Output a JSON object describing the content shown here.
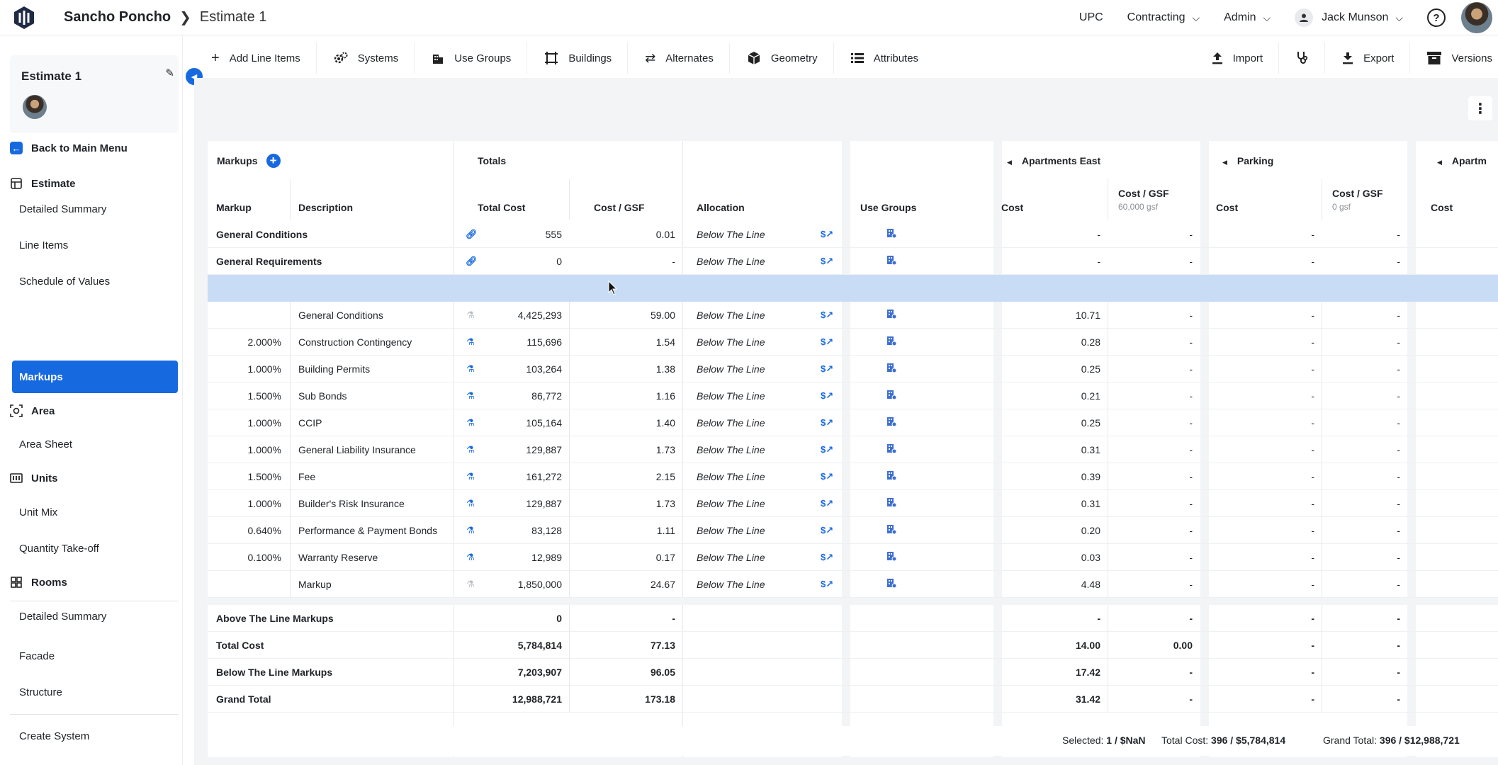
{
  "header": {
    "project": "Sancho Poncho",
    "estimate": "Estimate 1",
    "menu": [
      "UPC",
      "Contracting",
      "Admin"
    ],
    "user": "Jack Munson"
  },
  "sidebar": {
    "estimate_title": "Estimate 1",
    "back": "Back to Main Menu",
    "estimate_section": "Estimate",
    "estimate_items": [
      "Detailed Summary",
      "Line Items",
      "Schedule of Values",
      "Markups"
    ],
    "area_section": "Area",
    "area_items": [
      "Area Sheet"
    ],
    "units_section": "Units",
    "units_items": [
      "Unit Mix",
      "Quantity Take-off"
    ],
    "rooms_section": "Rooms",
    "rooms_items": [
      "Detailed Summary"
    ],
    "other_items": [
      "Facade",
      "Structure"
    ],
    "create": "Create System"
  },
  "toolbar": {
    "left": [
      "Add Line Items",
      "Systems",
      "Use Groups",
      "Buildings",
      "Alternates",
      "Geometry",
      "Attributes"
    ],
    "right": [
      "Import",
      "Export",
      "Versions"
    ]
  },
  "grid": {
    "groups": {
      "markups": "Markups",
      "totals": "Totals",
      "apartments_east": "Apartments East",
      "parking": "Parking",
      "apart_cut": "Apartm"
    },
    "headers": {
      "markup": "Markup",
      "description": "Description",
      "total_cost": "Total Cost",
      "cost_gsf": "Cost / GSF",
      "allocation": "Allocation",
      "use_groups": "Use Groups",
      "cost": "Cost",
      "apt_gsf": "60,000 gsf",
      "parking_gsf": "0 gsf"
    },
    "top_rows": [
      {
        "markup": "General Conditions",
        "total": "555",
        "gsf": "0.01",
        "alloc": "Below The Line",
        "ae_cost": "-",
        "ae_gsf": "-",
        "pk_cost": "-",
        "pk_gsf": "-"
      },
      {
        "markup": "General Requirements",
        "total": "0",
        "gsf": "-",
        "alloc": "Below The Line",
        "ae_cost": "-",
        "ae_gsf": "-",
        "pk_cost": "-",
        "pk_gsf": "-"
      }
    ],
    "rows": [
      {
        "pct": "",
        "desc": "General Conditions",
        "total": "4,425,293",
        "gsf": "59.00",
        "alloc": "Below The Line",
        "ae_cost": "10.71",
        "ae_gsf": "-",
        "pk_cost": "-",
        "pk_gsf": "-",
        "dim": true
      },
      {
        "pct": "2.000%",
        "desc": "Construction Contingency",
        "total": "115,696",
        "gsf": "1.54",
        "alloc": "Below The Line",
        "ae_cost": "0.28",
        "ae_gsf": "-",
        "pk_cost": "-",
        "pk_gsf": "-"
      },
      {
        "pct": "1.000%",
        "desc": "Building Permits",
        "total": "103,264",
        "gsf": "1.38",
        "alloc": "Below The Line",
        "ae_cost": "0.25",
        "ae_gsf": "-",
        "pk_cost": "-",
        "pk_gsf": "-"
      },
      {
        "pct": "1.500%",
        "desc": "Sub Bonds",
        "total": "86,772",
        "gsf": "1.16",
        "alloc": "Below The Line",
        "ae_cost": "0.21",
        "ae_gsf": "-",
        "pk_cost": "-",
        "pk_gsf": "-"
      },
      {
        "pct": "1.000%",
        "desc": "CCIP",
        "total": "105,164",
        "gsf": "1.40",
        "alloc": "Below The Line",
        "ae_cost": "0.25",
        "ae_gsf": "-",
        "pk_cost": "-",
        "pk_gsf": "-"
      },
      {
        "pct": "1.000%",
        "desc": "General Liability Insurance",
        "total": "129,887",
        "gsf": "1.73",
        "alloc": "Below The Line",
        "ae_cost": "0.31",
        "ae_gsf": "-",
        "pk_cost": "-",
        "pk_gsf": "-"
      },
      {
        "pct": "1.500%",
        "desc": "Fee",
        "total": "161,272",
        "gsf": "2.15",
        "alloc": "Below The Line",
        "ae_cost": "0.39",
        "ae_gsf": "-",
        "pk_cost": "-",
        "pk_gsf": "-"
      },
      {
        "pct": "1.000%",
        "desc": "Builder's Risk Insurance",
        "total": "129,887",
        "gsf": "1.73",
        "alloc": "Below The Line",
        "ae_cost": "0.31",
        "ae_gsf": "-",
        "pk_cost": "-",
        "pk_gsf": "-"
      },
      {
        "pct": "0.640%",
        "desc": "Performance & Payment Bonds",
        "total": "83,128",
        "gsf": "1.11",
        "alloc": "Below The Line",
        "ae_cost": "0.20",
        "ae_gsf": "-",
        "pk_cost": "-",
        "pk_gsf": "-"
      },
      {
        "pct": "0.100%",
        "desc": "Warranty Reserve",
        "total": "12,989",
        "gsf": "0.17",
        "alloc": "Below The Line",
        "ae_cost": "0.03",
        "ae_gsf": "-",
        "pk_cost": "-",
        "pk_gsf": "-"
      },
      {
        "pct": "",
        "desc": "Markup",
        "total": "1,850,000",
        "gsf": "24.67",
        "alloc": "Below The Line",
        "ae_cost": "4.48",
        "ae_gsf": "-",
        "pk_cost": "-",
        "pk_gsf": "-",
        "dim": true
      }
    ],
    "totals": [
      {
        "label": "Above The Line Markups",
        "total": "0",
        "gsf": "-",
        "ae_cost": "-",
        "ae_gsf": "-",
        "pk_cost": "-",
        "pk_gsf": "-"
      },
      {
        "label": "Total Cost",
        "total": "5,784,814",
        "gsf": "77.13",
        "ae_cost": "14.00",
        "ae_gsf": "0.00",
        "pk_cost": "-",
        "pk_gsf": "-"
      },
      {
        "label": "Below The Line Markups",
        "total": "7,203,907",
        "gsf": "96.05",
        "ae_cost": "17.42",
        "ae_gsf": "-",
        "pk_cost": "-",
        "pk_gsf": "-"
      },
      {
        "label": "Grand Total",
        "total": "12,988,721",
        "gsf": "173.18",
        "ae_cost": "31.42",
        "ae_gsf": "-",
        "pk_cost": "-",
        "pk_gsf": "-"
      }
    ]
  },
  "footer": {
    "selected_label": "Selected:",
    "selected_value": "1 / $NaN",
    "total_label": "Total Cost:",
    "total_value": "396 / $5,784,814",
    "grand_label": "Grand Total:",
    "grand_value": "396 / $12,988,721"
  },
  "colors": {
    "accent": "#1769e0",
    "selected_row": "#c9dcf6",
    "canvas": "#f3f4f6"
  }
}
